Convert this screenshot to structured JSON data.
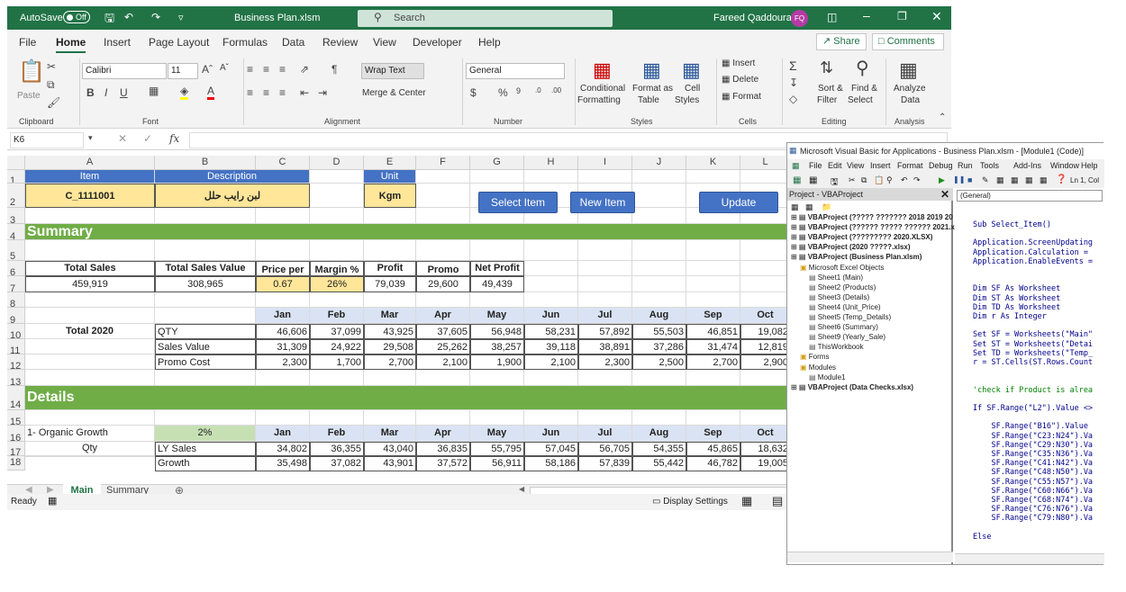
{
  "excel": {
    "autosave_label": "AutoSave",
    "autosave_state": "Off",
    "file_name": "Business Plan.xlsm",
    "search_placeholder": "Search",
    "user_name": "Fareed Qaddoura",
    "user_initials": "FQ",
    "menu_tabs": [
      "File",
      "Home",
      "Insert",
      "Page Layout",
      "Formulas",
      "Data",
      "Review",
      "View",
      "Developer",
      "Help"
    ],
    "share_label": "Share",
    "comments_label": "Comments",
    "ribbon": {
      "paste": "Paste",
      "clipboard": "Clipboard",
      "font_name": "Calibri",
      "font_size": "11",
      "font": "Font",
      "wrap_text": "Wrap Text",
      "merge_center": "Merge & Center",
      "alignment": "Alignment",
      "number_format": "General",
      "number": "Number",
      "cond_fmt_1": "Conditional",
      "cond_fmt_2": "Formatting",
      "fmt_table_1": "Format as",
      "fmt_table_2": "Table",
      "cell_styles_1": "Cell",
      "cell_styles_2": "Styles",
      "styles": "Styles",
      "insert": "Insert",
      "delete": "Delete",
      "format": "Format",
      "cells": "Cells",
      "sort_1": "Sort &",
      "sort_2": "Filter",
      "find_1": "Find &",
      "find_2": "Select",
      "editing": "Editing",
      "analyze_1": "Analyze",
      "analyze_2": "Data",
      "analysis": "Analysis"
    },
    "name_box": "K6",
    "col_headers": [
      "A",
      "B",
      "C",
      "D",
      "E",
      "F",
      "G",
      "H",
      "I",
      "J",
      "K",
      "L"
    ],
    "row_headers": [
      "1",
      "2",
      "3",
      "4",
      "5",
      "6",
      "7",
      "8",
      "9",
      "10",
      "11",
      "12",
      "13",
      "14",
      "15",
      "16",
      "17",
      "18"
    ],
    "item_header": "Item",
    "description_header": "Description",
    "unit_header": "Unit",
    "item_code": "C_1111001",
    "item_description": "لبن رايب حلل",
    "item_unit": "Kgm",
    "btn_select": "Select Item",
    "btn_new": "New Item",
    "btn_update": "Update",
    "summary_title": "Summary",
    "kpi_headers": [
      "Total Sales",
      "Total Sales Value",
      "Price per Unit",
      "Margin %",
      "Profit",
      "Promo Cost",
      "Net Profit"
    ],
    "kpi_values": [
      "459,919",
      "308,965",
      "0.67",
      "26%",
      "79,039",
      "29,600",
      "49,439"
    ],
    "months": [
      "Jan",
      "Feb",
      "Mar",
      "Apr",
      "May",
      "Jun",
      "Jul",
      "Aug",
      "Sep",
      "Oct"
    ],
    "total_label": "Total 2020",
    "metrics": [
      {
        "label": "QTY",
        "values": [
          "46,606",
          "37,099",
          "43,925",
          "37,605",
          "56,948",
          "58,231",
          "57,892",
          "55,503",
          "46,851",
          "19,082"
        ]
      },
      {
        "label": "Sales Value",
        "values": [
          "31,309",
          "24,922",
          "29,508",
          "25,262",
          "38,257",
          "39,118",
          "38,891",
          "37,286",
          "31,474",
          "12,819"
        ]
      },
      {
        "label": "Promo Cost",
        "values": [
          "2,300",
          "1,700",
          "2,700",
          "2,100",
          "1,900",
          "2,100",
          "2,300",
          "2,500",
          "2,700",
          "2,900"
        ]
      }
    ],
    "details_title": "Details",
    "organic_label": "1- Organic Growth",
    "organic_pct": "2%",
    "qty_label": "Qty",
    "detail_rows": [
      {
        "label": "LY Sales",
        "values": [
          "34,802",
          "36,355",
          "43,040",
          "36,835",
          "55,795",
          "57,045",
          "56,705",
          "54,355",
          "45,865",
          "18,632"
        ]
      },
      {
        "label": "Growth",
        "values": [
          "35,498",
          "37,082",
          "43,901",
          "37,572",
          "56,911",
          "58,186",
          "57,839",
          "55,442",
          "46,782",
          "19,005"
        ]
      }
    ],
    "sheet_tabs": [
      "Main",
      "Summary"
    ],
    "status_ready": "Ready",
    "display_settings": "Display Settings"
  },
  "vbe": {
    "title": "Microsoft Visual Basic for Applications - Business Plan.xlsm - [Module1 (Code)]",
    "menus": [
      "File",
      "Edit",
      "View",
      "Insert",
      "Format",
      "Debug",
      "Run",
      "Tools",
      "Add-Ins",
      "Window",
      "Help"
    ],
    "position": "Ln 1, Col",
    "project_title": "Project - VBAProject",
    "general": "(General)",
    "tree": [
      {
        "text": "VBAProject (????? ???????  2018 2019 20",
        "bold": true,
        "indent": 0
      },
      {
        "text": "VBAProject (?????? ????? ?????? 2021.xl",
        "bold": true,
        "indent": 0
      },
      {
        "text": "VBAProject (????????? 2020.XLSX)",
        "bold": true,
        "indent": 0
      },
      {
        "text": "VBAProject (2020 ?????.xlsx)",
        "bold": true,
        "indent": 0
      },
      {
        "text": "VBAProject (Business Plan.xlsm)",
        "bold": true,
        "indent": 0
      },
      {
        "text": "Microsoft Excel Objects",
        "bold": false,
        "indent": 1
      },
      {
        "text": "Sheet1 (Main)",
        "bold": false,
        "indent": 2
      },
      {
        "text": "Sheet2 (Products)",
        "bold": false,
        "indent": 2
      },
      {
        "text": "Sheet3 (Details)",
        "bold": false,
        "indent": 2
      },
      {
        "text": "Sheet4 (Unit_Price)",
        "bold": false,
        "indent": 2
      },
      {
        "text": "Sheet5 (Temp_Details)",
        "bold": false,
        "indent": 2
      },
      {
        "text": "Sheet6 (Summary)",
        "bold": false,
        "indent": 2
      },
      {
        "text": "Sheet9 (Yearly_Sale)",
        "bold": false,
        "indent": 2
      },
      {
        "text": "ThisWorkbook",
        "bold": false,
        "indent": 2
      },
      {
        "text": "Forms",
        "bold": false,
        "indent": 1
      },
      {
        "text": "Modules",
        "bold": false,
        "indent": 1
      },
      {
        "text": "Module1",
        "bold": false,
        "indent": 2
      },
      {
        "text": "VBAProject (Data Checks.xlsx)",
        "bold": true,
        "indent": 0
      }
    ],
    "code": [
      "Sub Select_Item()",
      "",
      "Application.ScreenUpdating",
      "Application.Calculation =",
      "Application.EnableEvents =",
      "",
      "",
      "Dim SF As Worksheet",
      "Dim ST As Worksheet",
      "Dim TD As Worksheet",
      "Dim r As Integer",
      "",
      "Set SF = Worksheets(\"Main\"",
      "Set ST = Worksheets(\"Detai",
      "Set TD = Worksheets(\"Temp_",
      "r = ST.Cells(ST.Rows.Count",
      "",
      "",
      "'check if Product is alrea",
      "",
      "If SF.Range(\"L2\").Value <>",
      "",
      "    SF.Range(\"B16\").Value",
      "    SF.Range(\"C23:N24\").Va",
      "    SF.Range(\"C29:N30\").Va",
      "    SF.Range(\"C35:N36\").Va",
      "    SF.Range(\"C41:N42\").Va",
      "    SF.Range(\"C48:N50\").Va",
      "    SF.Range(\"C55:N57\").Va",
      "    SF.Range(\"C60:N66\").Va",
      "    SF.Range(\"C68:N74\").Va",
      "    SF.Range(\"C76:N76\").Va",
      "    SF.Range(\"C79:N80\").Va",
      "",
      "Else"
    ]
  }
}
